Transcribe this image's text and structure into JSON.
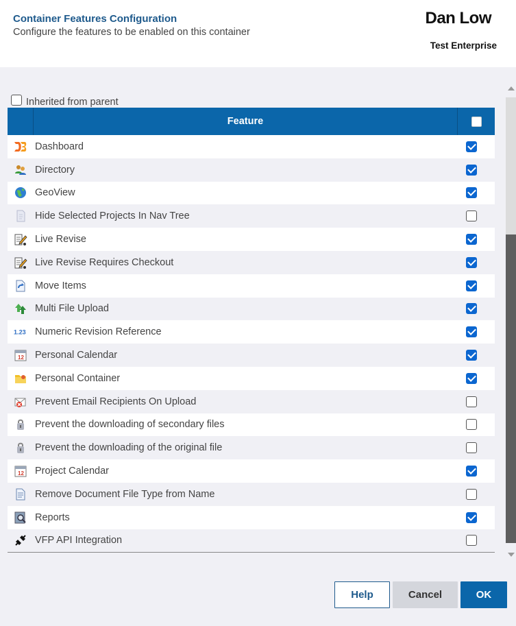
{
  "header": {
    "title": "Container Features Configuration",
    "subtitle": "Configure the features to be enabled on this container",
    "user_name": "Dan Low",
    "org_name": "Test Enterprise"
  },
  "inherit": {
    "label": "Inherited from parent",
    "checked": false
  },
  "table": {
    "header_label": "Feature",
    "rows": [
      {
        "label": "Dashboard",
        "icon": "d3-icon",
        "checked": true
      },
      {
        "label": "Directory",
        "icon": "users-icon",
        "checked": true
      },
      {
        "label": "GeoView",
        "icon": "globe-icon",
        "checked": true
      },
      {
        "label": "Hide Selected Projects In Nav Tree",
        "icon": "hidden-page-icon",
        "checked": false
      },
      {
        "label": "Live Revise",
        "icon": "edit-doc-icon",
        "checked": true
      },
      {
        "label": "Live Revise Requires Checkout",
        "icon": "edit-doc-icon",
        "checked": true
      },
      {
        "label": "Move Items",
        "icon": "move-doc-icon",
        "checked": true
      },
      {
        "label": "Multi File Upload",
        "icon": "upload-arrows-icon",
        "checked": true
      },
      {
        "label": "Numeric Revision Reference",
        "icon": "numeric-icon",
        "checked": true
      },
      {
        "label": "Personal Calendar",
        "icon": "calendar-icon",
        "checked": true
      },
      {
        "label": "Personal Container",
        "icon": "folder-icon",
        "checked": true
      },
      {
        "label": "Prevent Email Recipients On Upload",
        "icon": "email-block-icon",
        "checked": false
      },
      {
        "label": "Prevent the downloading of secondary files",
        "icon": "lock-icon",
        "checked": false
      },
      {
        "label": "Prevent the downloading of the original file",
        "icon": "lock-icon",
        "checked": false
      },
      {
        "label": "Project Calendar",
        "icon": "calendar-icon",
        "checked": true
      },
      {
        "label": "Remove Document File Type from Name",
        "icon": "document-icon",
        "checked": false
      },
      {
        "label": "Reports",
        "icon": "reports-icon",
        "checked": true
      },
      {
        "label": "VFP API Integration",
        "icon": "plug-icon",
        "checked": false
      }
    ]
  },
  "buttons": {
    "help": "Help",
    "cancel": "Cancel",
    "ok": "OK"
  },
  "colors": {
    "accent": "#0b66aa",
    "title": "#1e5a8c",
    "checkbox": "#0b66d0"
  }
}
